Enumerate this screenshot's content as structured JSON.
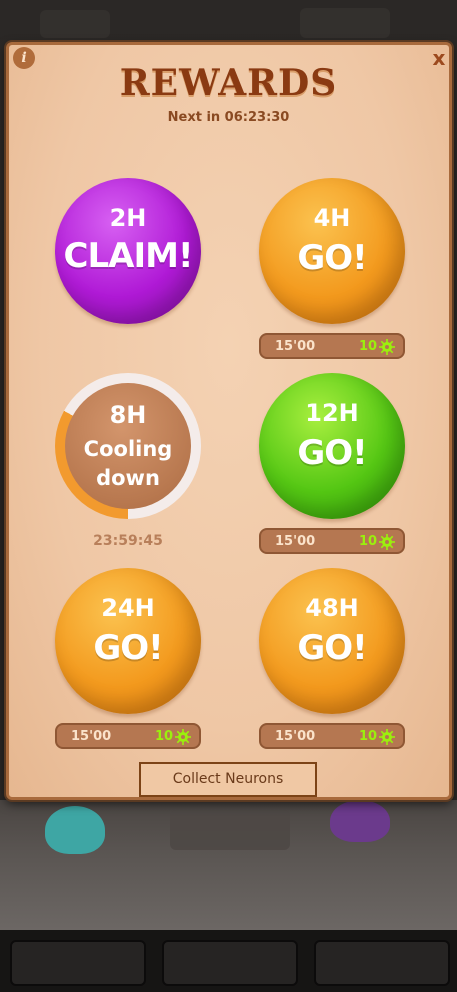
{
  "header": {
    "title": "REWARDS",
    "next_text": "Next in 06:23:30",
    "info_label": "i",
    "close_label": "x"
  },
  "rewards": [
    {
      "hours": "2H",
      "action": "CLAIM!",
      "state": "claim",
      "color": "#b01ad6"
    },
    {
      "hours": "4H",
      "action": "GO!",
      "state": "go",
      "color": "#f39a1e",
      "time": "15'00",
      "count": "10"
    },
    {
      "hours": "8H",
      "action": "Cooling down",
      "state": "cooling",
      "color": "#b8784f",
      "timer": "23:59:45",
      "progress": 0.33
    },
    {
      "hours": "12H",
      "action": "GO!",
      "state": "go",
      "color": "#55c714",
      "time": "15'00",
      "count": "10"
    },
    {
      "hours": "24H",
      "action": "GO!",
      "state": "go",
      "color": "#f39a1e",
      "time": "15'00",
      "count": "10"
    },
    {
      "hours": "48H",
      "action": "GO!",
      "state": "go",
      "color": "#f39a1e",
      "time": "15'00",
      "count": "10"
    }
  ],
  "reward_icon": "neuron-virus-icon",
  "collect_button": {
    "label": "Collect Neurons"
  }
}
